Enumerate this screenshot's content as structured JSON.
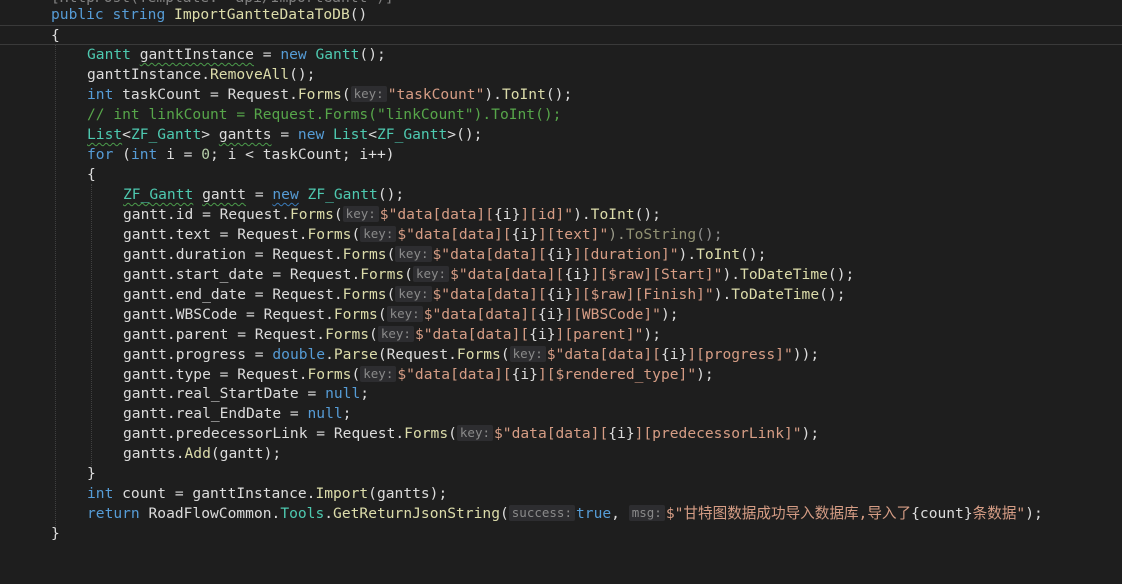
{
  "code": {
    "attribute_line": "[HttpPost(Template: \"api/ImportGantt\")]",
    "signature": {
      "kw_public": "public",
      "kw_string": "string",
      "method_name": "ImportGantteDataToDB",
      "parens": "()"
    },
    "open_brace": "{",
    "close_brace": "}",
    "lines": {
      "l1": {
        "t1": "Gantt",
        "t2": "ganttInstance",
        "t3": " = ",
        "t4": "new",
        "t5": "Gantt",
        "t6": "();"
      },
      "l2": {
        "t1": "ganttInstance.",
        "t2": "RemoveAll",
        "t3": "();"
      },
      "l3": {
        "t1": "int",
        "t2": " taskCount = Request.",
        "t3": "Forms",
        "t4": "(",
        "hint": "key:",
        "t5": "\"taskCount\"",
        "t6": ").",
        "t7": "ToInt",
        "t8": "();"
      },
      "l4": {
        "t1": "// int linkCount = Request.Forms(\"linkCount\").ToInt();"
      },
      "l5": {
        "t1": "List",
        "t2": "<",
        "t3": "ZF_Gantt",
        "t4": "> ",
        "t5": "gantts",
        "t6": " = ",
        "t7": "new",
        "t8": " List",
        "t9": "<",
        "t10": "ZF_Gantt",
        "t11": ">();"
      },
      "l6": {
        "t1": "for",
        "t2": " (",
        "t3": "int",
        "t4": " i = ",
        "t5": "0",
        "t6": "; i < taskCount; i++)"
      },
      "l7": {
        "t1": "{"
      },
      "l8": {
        "t1": "ZF_Gantt",
        "t2": " ",
        "t3": "gantt",
        "t4": " = ",
        "t5": "new",
        "t6": " ZF_Gantt",
        "t7": "();"
      },
      "l9": {
        "t1": "gantt.id = Request.",
        "t2": "Forms",
        "t3": "(",
        "hint": "key:",
        "t4": "$\"data[data][",
        "t5": "{i}",
        "t6": "][id]\"",
        "t7": ").",
        "t8": "ToInt",
        "t9": "();"
      },
      "l10": {
        "t1": "gantt.text = Request.",
        "t2": "Forms",
        "t3": "(",
        "hint": "key:",
        "t4": "$\"data[data][",
        "t5": "{i}",
        "t6": "][text]\"",
        "t7": ").",
        "t8": "ToString",
        "t9": "();"
      },
      "l11": {
        "t1": "gantt.duration = Request.",
        "t2": "Forms",
        "t3": "(",
        "hint": "key:",
        "t4": "$\"data[data][",
        "t5": "{i}",
        "t6": "][duration]\"",
        "t7": ").",
        "t8": "ToInt",
        "t9": "();"
      },
      "l12": {
        "t1": "gantt.start_date = Request.",
        "t2": "Forms",
        "t3": "(",
        "hint": "key:",
        "t4": "$\"data[data][",
        "t5": "{i}",
        "t6": "][$raw][Start]\"",
        "t7": ").",
        "t8": "ToDateTime",
        "t9": "();"
      },
      "l13": {
        "t1": "gantt.end_date = Request.",
        "t2": "Forms",
        "t3": "(",
        "hint": "key:",
        "t4": "$\"data[data][",
        "t5": "{i}",
        "t6": "][$raw][Finish]\"",
        "t7": ").",
        "t8": "ToDateTime",
        "t9": "();"
      },
      "l14": {
        "t1": "gantt.WBSCode = Request.",
        "t2": "Forms",
        "t3": "(",
        "hint": "key:",
        "t4": "$\"data[data][",
        "t5": "{i}",
        "t6": "][WBSCode]\"",
        "t7": ");"
      },
      "l15": {
        "t1": "gantt.parent = Request.",
        "t2": "Forms",
        "t3": "(",
        "hint": "key:",
        "t4": "$\"data[data][",
        "t5": "{i}",
        "t6": "][parent]\"",
        "t7": ");"
      },
      "l16": {
        "t1": "gantt.progress = ",
        "t2": "double",
        "t3": ".",
        "t4": "Parse",
        "t5": "(Request.",
        "t6": "Forms",
        "t7": "(",
        "hint": "key:",
        "t8": "$\"data[data][",
        "t9": "{i}",
        "t10": "][progress]\"",
        "t11": "));"
      },
      "l17": {
        "t1": "gantt.type = Request.",
        "t2": "Forms",
        "t3": "(",
        "hint": "key:",
        "t4": "$\"data[data][",
        "t5": "{i}",
        "t6": "][$rendered_type]\"",
        "t7": ");"
      },
      "l18": {
        "t1": "gantt.real_StartDate = ",
        "t2": "null",
        "t3": ";"
      },
      "l19": {
        "t1": "gantt.real_EndDate = ",
        "t2": "null",
        "t3": ";"
      },
      "l20": {
        "t1": "gantt.predecessorLink = Request.",
        "t2": "Forms",
        "t3": "(",
        "hint": "key:",
        "t4": "$\"data[data][",
        "t5": "{i}",
        "t6": "][predecessorLink]\"",
        "t7": ");"
      },
      "l21": {
        "t1": "gantts.",
        "t2": "Add",
        "t3": "(gantt);"
      },
      "l22": {
        "t1": "}"
      },
      "l23": {
        "t1": "int",
        "t2": " count = ganttInstance.",
        "t3": "Import",
        "t4": "(gantts);"
      },
      "l24": {
        "t1": "return",
        "t2": " RoadFlowCommon.",
        "t3": "Tools",
        "t4": ".",
        "t5": "GetReturnJsonString",
        "t6": "(",
        "hint1": "success:",
        "t7": "true",
        "t8": ", ",
        "hint2": "msg:",
        "t9": "$\"甘特图数据成功导入数据库,导入了",
        "t10": "{count}",
        "t11": "条数据\"",
        "t12": ");"
      }
    }
  },
  "colors": {
    "background": "#1e1e1e",
    "keyword": "#569cd6",
    "type": "#4ec9b0",
    "method": "#dcdcaa",
    "string": "#d69d85",
    "comment": "#57a64a"
  }
}
